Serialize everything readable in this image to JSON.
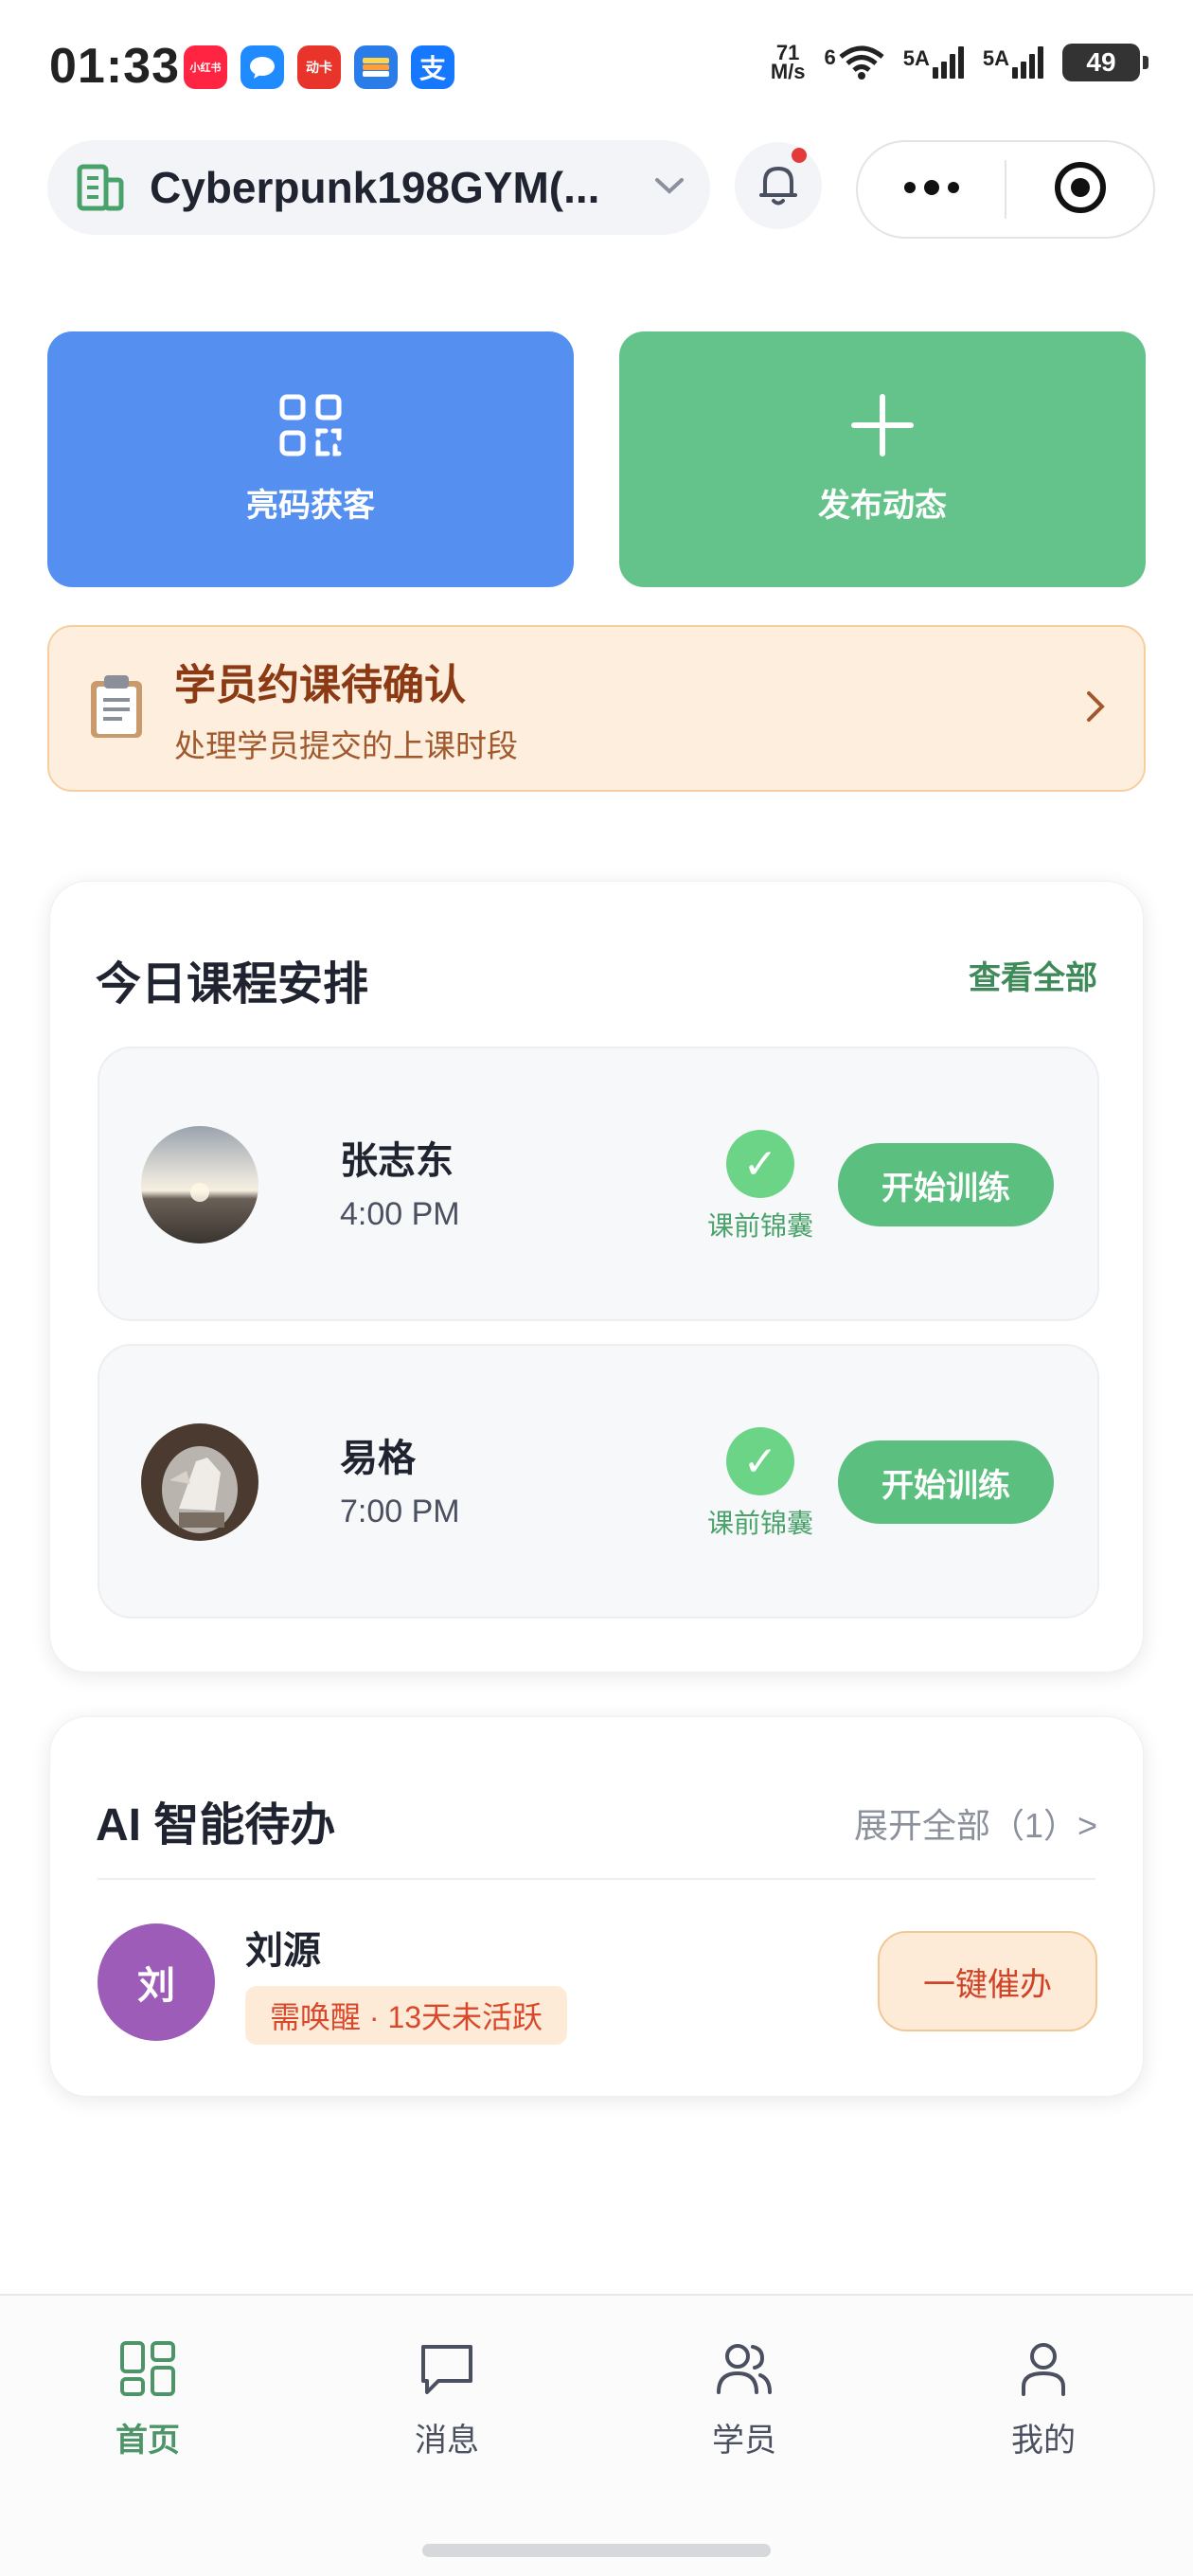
{
  "status_bar": {
    "time": "01:33",
    "apps": [
      {
        "name": "xiaohongshu-app-icon",
        "label": "小红书",
        "color": "#ff2442"
      },
      {
        "name": "messages-app-icon",
        "label": "",
        "color": "#1f8bff"
      },
      {
        "name": "dongdi-app-icon",
        "label": "动卡",
        "color": "#e8342a"
      },
      {
        "name": "wallet-app-icon",
        "label": "",
        "color": "#2a7de8"
      },
      {
        "name": "alipay-app-icon",
        "label": "支",
        "color": "#1677ff"
      }
    ],
    "net_speed_value": "71",
    "net_speed_unit": "M/s",
    "wifi_label": "6",
    "sim1_label": "5A",
    "sim2_label": "5A",
    "battery": "49"
  },
  "header": {
    "gym_name": "Cyberpunk198GYM(...",
    "has_notification": true
  },
  "quick_actions": {
    "scan": {
      "label": "亮码获客",
      "color": "#5590f0"
    },
    "post": {
      "label": "发布动态",
      "color": "#64c38a"
    }
  },
  "booking_banner": {
    "title": "学员约课待确认",
    "subtitle": "处理学员提交的上课时段"
  },
  "schedule": {
    "title": "今日课程安排",
    "view_all": "查看全部",
    "sessions": [
      {
        "name": "张志东",
        "time": "4:00 PM",
        "tips_label": "课前锦囊",
        "action": "开始训练"
      },
      {
        "name": "易格",
        "time": "7:00 PM",
        "tips_label": "课前锦囊",
        "action": "开始训练"
      }
    ]
  },
  "ai_todo": {
    "title": "AI 智能待办",
    "expand": "展开全部（1）>",
    "items": [
      {
        "avatar_text": "刘",
        "name": "刘源",
        "tag": "需唤醒 · 13天未活跃",
        "action": "一键催办"
      }
    ]
  },
  "tabbar": {
    "items": [
      {
        "label": "首页",
        "icon": "home-grid-icon",
        "active": true
      },
      {
        "label": "消息",
        "icon": "message-icon",
        "active": false
      },
      {
        "label": "学员",
        "icon": "students-icon",
        "active": false
      },
      {
        "label": "我的",
        "icon": "profile-icon",
        "active": false
      }
    ],
    "active_color": "#4d9468"
  }
}
